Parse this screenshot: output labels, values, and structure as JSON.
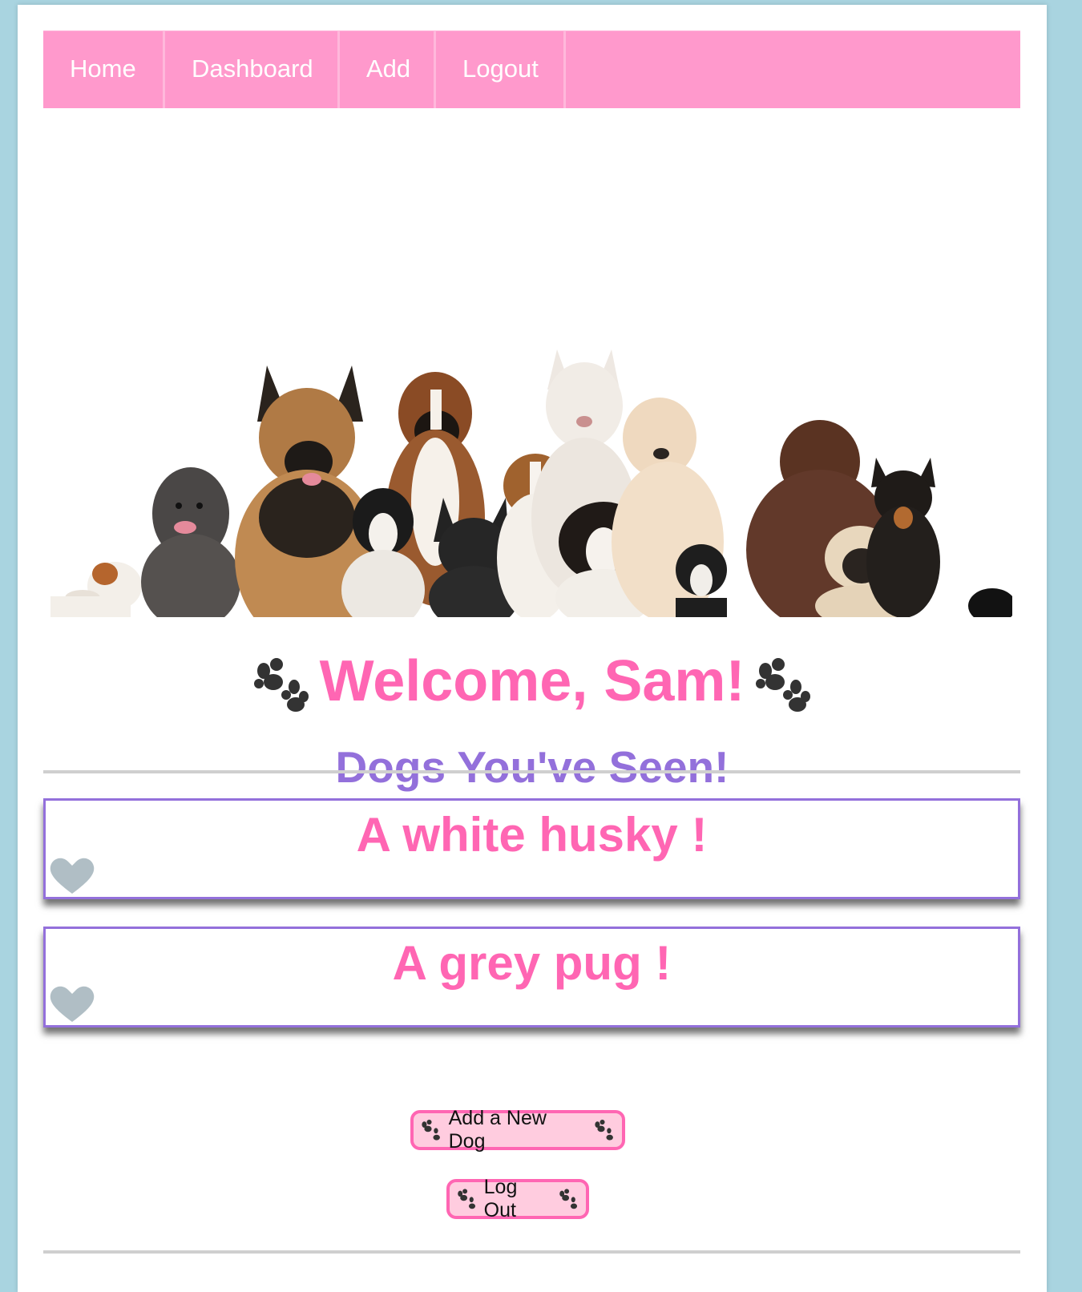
{
  "nav": {
    "items": [
      {
        "label": "Home"
      },
      {
        "label": "Dashboard"
      },
      {
        "label": "Add"
      },
      {
        "label": "Logout"
      }
    ]
  },
  "hero": {
    "alt": "Group of dogs"
  },
  "welcome": {
    "title": "Welcome, Sam!"
  },
  "section": {
    "title": "Dogs You've Seen!"
  },
  "dogs": [
    {
      "title": "A white husky !"
    },
    {
      "title": "A grey pug !"
    }
  ],
  "buttons": {
    "add_label": "Add a New Dog",
    "logout_label": "Log Out"
  },
  "colors": {
    "background": "#a9d4e0",
    "nav": "#ff99cc",
    "pink": "#ff66b3",
    "purple": "#9370db",
    "heart": "#b0bec5"
  }
}
